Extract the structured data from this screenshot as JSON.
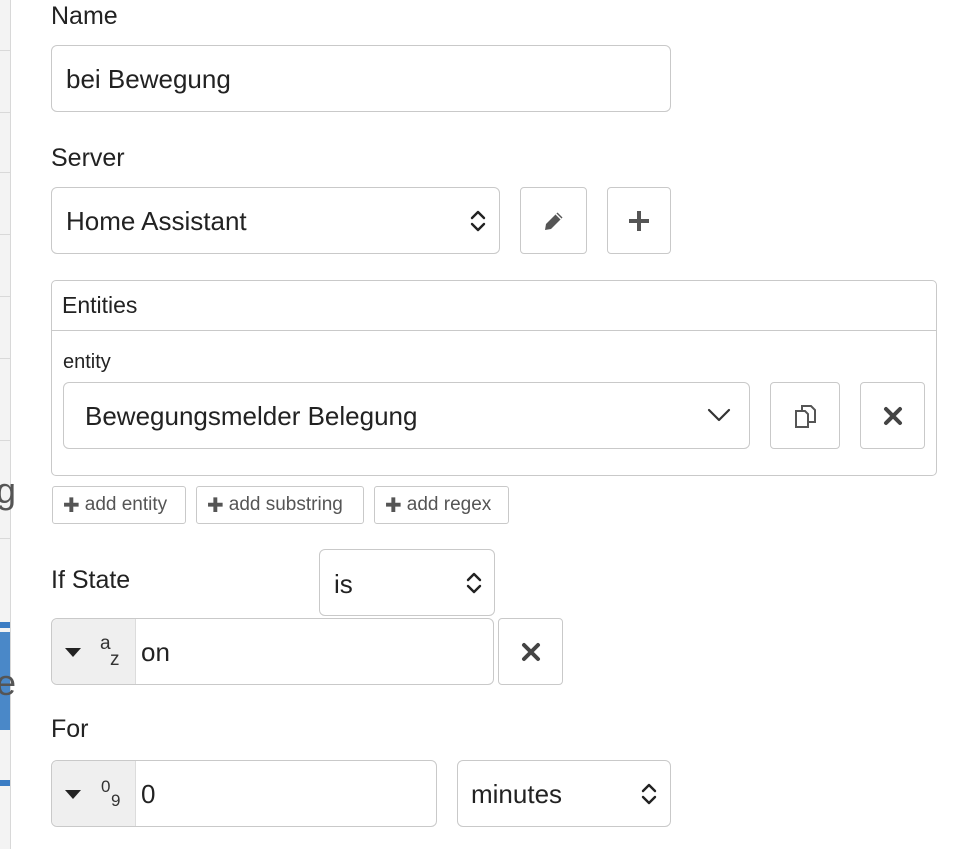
{
  "name": {
    "label": "Name",
    "value": "bei Bewegung"
  },
  "server": {
    "label": "Server",
    "value": "Home Assistant"
  },
  "entities": {
    "header": "Entities",
    "row_label": "entity",
    "value": "Bewegungsmelder Belegung",
    "add_entity": "add entity",
    "add_substring": "add substring",
    "add_regex": "add regex"
  },
  "if_state": {
    "label": "If State",
    "operator": "is",
    "type_glyph_top": "a",
    "type_glyph_bottom": "z",
    "value": "on"
  },
  "for": {
    "label": "For",
    "type_glyph_top": "0",
    "type_glyph_bottom": "9",
    "value": "0",
    "unit": "minutes"
  },
  "background": {
    "glyph1": "g",
    "glyph2": "e"
  }
}
